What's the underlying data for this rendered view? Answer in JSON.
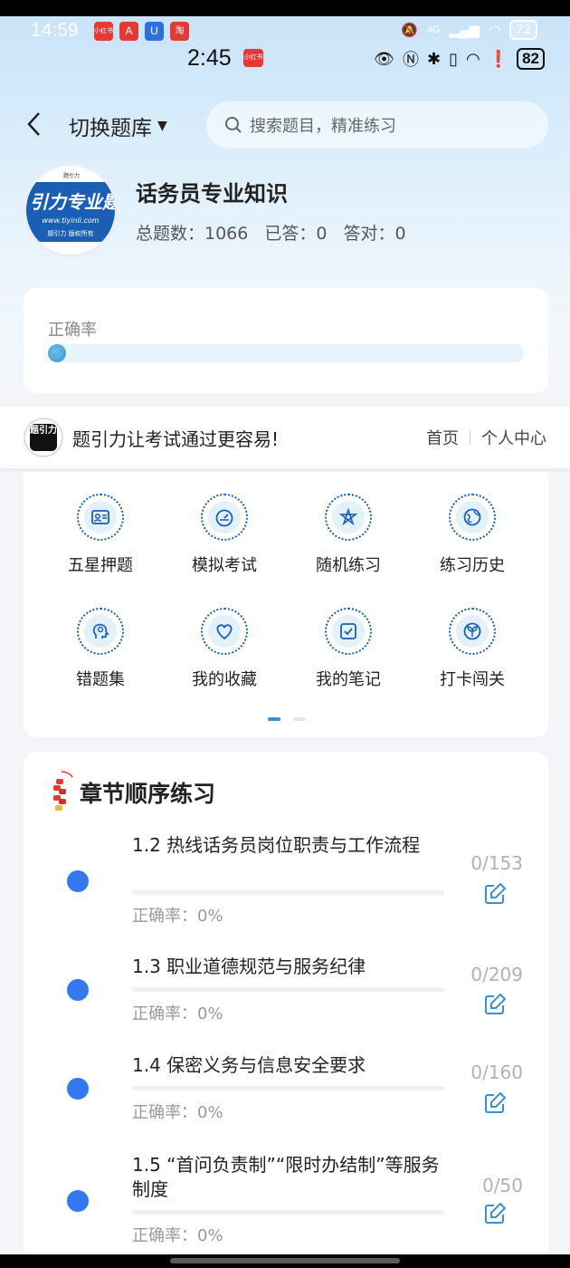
{
  "status_bar_outer": {
    "time": "14:59",
    "mini_apps": [
      "小红书",
      "A",
      "U",
      "淘"
    ],
    "battery": "72",
    "network": "4G"
  },
  "status_bar_inner": {
    "time": "2:45",
    "mini_app": "小红书",
    "battery": "82"
  },
  "header": {
    "back_icon": "chevron-left-icon",
    "switch_label": "切换题库",
    "search_placeholder": "搜索题目，精准练习"
  },
  "bank": {
    "logo_big_text": "引力专业题",
    "logo_url": "www.tiyinli.com",
    "logo_copyright": "题引力 版权所有",
    "logo_tiny": "题引力",
    "title": "话务员专业知识",
    "total_label": "总题数：1066",
    "answered_label": "已答：0",
    "correct_label": "答对：0"
  },
  "accuracy": {
    "label": "正确率",
    "value_percent": 0
  },
  "ad_bar": {
    "logo_text": "题引力",
    "slogan": "题引力让考试通过更容易!",
    "nav": [
      "首页",
      "个人中心"
    ]
  },
  "menu": {
    "items": [
      {
        "label": "五星押题",
        "icon": "id-card-icon"
      },
      {
        "label": "模拟考试",
        "icon": "gauge-icon"
      },
      {
        "label": "随机练习",
        "icon": "shuffle-icon"
      },
      {
        "label": "练习历史",
        "icon": "globe-icon"
      },
      {
        "label": "错题集",
        "icon": "head-icon"
      },
      {
        "label": "我的收藏",
        "icon": "heart-icon"
      },
      {
        "label": "我的笔记",
        "icon": "note-check-icon"
      },
      {
        "label": "打卡闯关",
        "icon": "leaf-icon"
      }
    ],
    "page_dots": 2,
    "active_page": 1
  },
  "chapters": {
    "title": "章节顺序练习",
    "items": [
      {
        "title": "1.2 热线话务员岗位职责与工作流程",
        "accuracy": "正确率：0%",
        "count": "0/153"
      },
      {
        "title": "1.3 职业道德规范与服务纪律",
        "accuracy": "正确率：0%",
        "count": "0/209"
      },
      {
        "title": "1.4 保密义务与信息安全要求",
        "accuracy": "正确率：0%",
        "count": "0/160"
      },
      {
        "title": "1.5 “首问负责制”“限时办结制”等服务制度",
        "accuracy": "正确率：0%",
        "count": "0/50"
      }
    ]
  },
  "colors": {
    "accent": "#3478f0",
    "brand_blue": "#1a5fb4",
    "hero_top": "#c9e3f8"
  }
}
